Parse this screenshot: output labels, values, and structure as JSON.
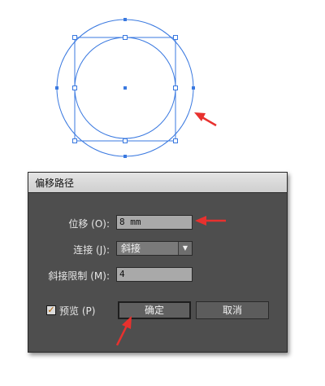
{
  "colors": {
    "selection": "#3a79e0",
    "arrow": "#e8312e",
    "dialog_bg": "#4e4e4e"
  },
  "dialog": {
    "title": "偏移路径",
    "offset": {
      "label": "位移 (O):",
      "value": "8 mm"
    },
    "joins": {
      "label": "连接 (J):",
      "value": "斜接"
    },
    "miter_limit": {
      "label": "斜接限制 (M):",
      "value": "4"
    },
    "preview": {
      "label": "预览 (P)",
      "checked": true
    },
    "ok_label": "确定",
    "cancel_label": "取消"
  }
}
